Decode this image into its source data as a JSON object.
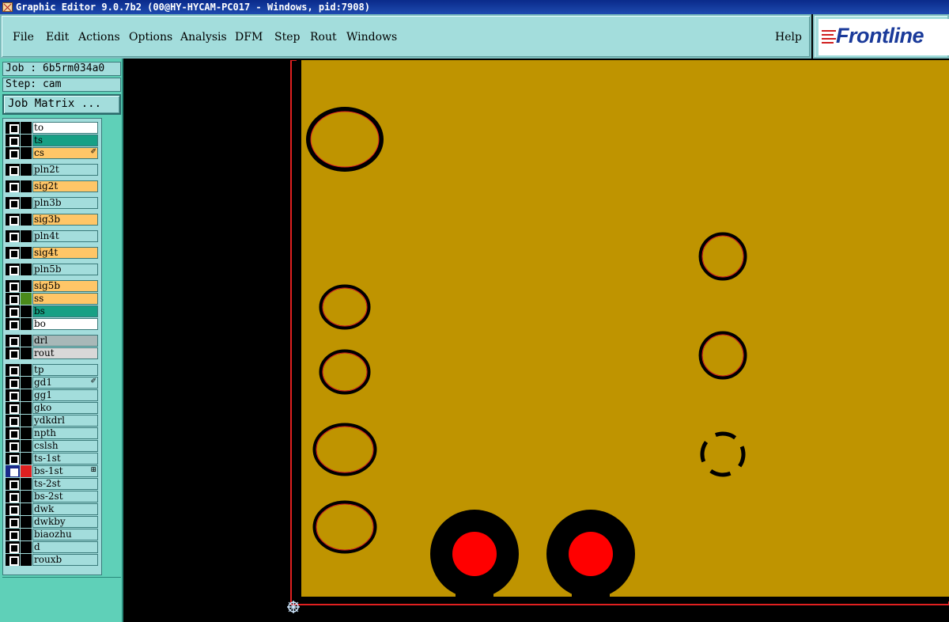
{
  "window": {
    "title": "Graphic Editor 9.0.7b2 (00@HY-HYCAM-PC017 - Windows, pid:7908)"
  },
  "menu": {
    "items": [
      "File",
      "Edit",
      "Actions",
      "Options",
      "Analysis",
      "DFM",
      "Step",
      "Rout",
      "Windows"
    ],
    "help": "Help"
  },
  "logo": {
    "text": "Frontline"
  },
  "job": {
    "job_label": "Job : 6b5rm034a0",
    "step_label": "Step: cam",
    "matrix_button": "Job Matrix ..."
  },
  "layers": [
    {
      "name": "to",
      "bg": "#ffffff",
      "swatch": "#000000"
    },
    {
      "name": "ts",
      "bg": "#17a085",
      "swatch": "#000000"
    },
    {
      "name": "cs",
      "bg": "#ffc667",
      "swatch": "#000000",
      "mark": "✐"
    },
    {
      "name": "pln2t",
      "bg": "#a3dddc",
      "swatch": "#000000"
    },
    {
      "name": "sig2t",
      "bg": "#ffc667",
      "swatch": "#000000"
    },
    {
      "name": "pln3b",
      "bg": "#a3dddc",
      "swatch": "#000000"
    },
    {
      "name": "sig3b",
      "bg": "#ffc667",
      "swatch": "#000000"
    },
    {
      "name": "pln4t",
      "bg": "#a3dddc",
      "swatch": "#000000"
    },
    {
      "name": "sig4t",
      "bg": "#ffc667",
      "swatch": "#000000"
    },
    {
      "name": "pln5b",
      "bg": "#a3dddc",
      "swatch": "#000000"
    },
    {
      "name": "sig5b",
      "bg": "#ffc667",
      "swatch": "#000000"
    },
    {
      "name": "ss",
      "bg": "#ffc667",
      "swatch": "#4a8a1a"
    },
    {
      "name": "bs",
      "bg": "#17a085",
      "swatch": "#000000"
    },
    {
      "name": "bo",
      "bg": "#ffffff",
      "swatch": "#000000"
    },
    {
      "name": "drl",
      "bg": "#a8b8b8",
      "swatch": "#000000"
    },
    {
      "name": "rout",
      "bg": "#d8d8d8",
      "swatch": "#000000"
    },
    {
      "name": "tp",
      "bg": "#a3dddc",
      "swatch": "#000000"
    },
    {
      "name": "gd1",
      "bg": "#a3dddc",
      "swatch": "#000000",
      "mark": "✐"
    },
    {
      "name": "gg1",
      "bg": "#a3dddc",
      "swatch": "#000000"
    },
    {
      "name": "gko",
      "bg": "#a3dddc",
      "swatch": "#000000"
    },
    {
      "name": "ydkdrl",
      "bg": "#a3dddc",
      "swatch": "#000000"
    },
    {
      "name": "npth",
      "bg": "#a3dddc",
      "swatch": "#000000"
    },
    {
      "name": "cslsh",
      "bg": "#a3dddc",
      "swatch": "#000000"
    },
    {
      "name": "ts-1st",
      "bg": "#a3dddc",
      "swatch": "#000000"
    },
    {
      "name": "bs-1st",
      "bg": "#a3dddc",
      "swatch": "#e02020",
      "selected": true,
      "mark": "⊞"
    },
    {
      "name": "ts-2st",
      "bg": "#a3dddc",
      "swatch": "#000000"
    },
    {
      "name": "bs-2st",
      "bg": "#a3dddc",
      "swatch": "#000000"
    },
    {
      "name": "dwk",
      "bg": "#a3dddc",
      "swatch": "#000000"
    },
    {
      "name": "dwkby",
      "bg": "#a3dddc",
      "swatch": "#000000"
    },
    {
      "name": "biaozhu",
      "bg": "#a3dddc",
      "swatch": "#000000"
    },
    {
      "name": "d",
      "bg": "#a3dddc",
      "swatch": "#000000"
    },
    {
      "name": "rouxb",
      "bg": "#a3dddc",
      "swatch": "#000000"
    }
  ],
  "colors": {
    "board": "#bf9400",
    "pad": "#000000",
    "pad_outline": "#e02020",
    "via_fill": "#ff0000",
    "panel": "#a3dddc",
    "panel_dark": "#5fd0b8"
  },
  "icons": {
    "app": "graphic-editor-icon",
    "origin": "origin-crosshair-icon"
  }
}
